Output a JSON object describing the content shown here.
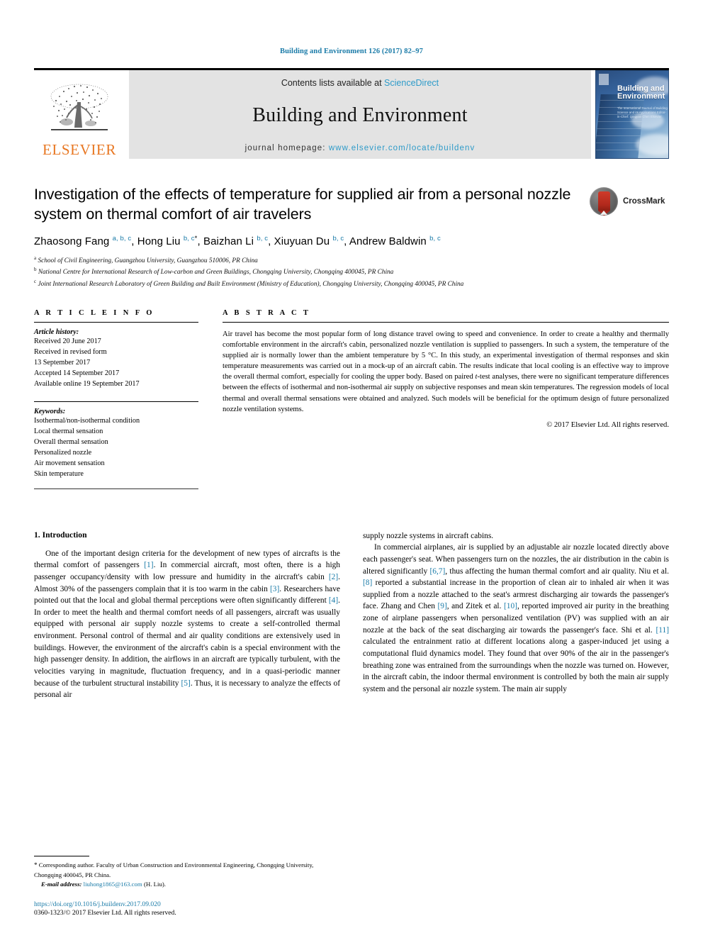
{
  "running_head": "Building and Environment 126 (2017) 82–97",
  "masthead": {
    "publisher_logo_label": "ELSEVIER",
    "contents_prefix": "Contents lists available at ",
    "contents_link": "ScienceDirect",
    "journal_title": "Building and Environment",
    "homepage_prefix": "journal homepage: ",
    "homepage_url": "www.elsevier.com/locate/buildenv",
    "cover_title_line1": "Building and",
    "cover_title_line2": "Environment",
    "cover_subtitle": "The International Journal of Building Science and its Applications Editor-in-Chief: Qingyan Chen  Elsevier"
  },
  "article": {
    "title": "Investigation of the effects of temperature for supplied air from a personal nozzle system on thermal comfort of air travelers",
    "authors": [
      {
        "name": "Zhaosong Fang",
        "marks": "a, b, c",
        "star": ""
      },
      {
        "name": "Hong Liu",
        "marks": "b, c",
        "star": "*"
      },
      {
        "name": "Baizhan Li",
        "marks": "b, c",
        "star": ""
      },
      {
        "name": "Xiuyuan Du",
        "marks": "b, c",
        "star": ""
      },
      {
        "name": "Andrew Baldwin",
        "marks": "b, c",
        "star": ""
      }
    ],
    "affiliations": [
      {
        "mark": "a",
        "text": "School of Civil Engineering, Guangzhou University, Guangzhou 510006, PR China"
      },
      {
        "mark": "b",
        "text": "National Centre for International Research of Low-carbon and Green Buildings, Chongqing University, Chongqing 400045, PR China"
      },
      {
        "mark": "c",
        "text": "Joint International Research Laboratory of Green Building and Built Environment (Ministry of Education), Chongqing University, Chongqing 400045, PR China"
      }
    ],
    "crossmark_label": "CrossMark"
  },
  "article_info": {
    "heading": "A R T I C L E  I N F O",
    "history_label": "Article history:",
    "history_lines": [
      "Received 20 June 2017",
      "Received in revised form",
      "13 September 2017",
      "Accepted 14 September 2017",
      "Available online 19 September 2017"
    ],
    "keywords_label": "Keywords:",
    "keywords": [
      "Isothermal/non-isothermal condition",
      "Local thermal sensation",
      "Overall thermal sensation",
      "Personalized nozzle",
      "Air movement sensation",
      "Skin temperature"
    ]
  },
  "abstract": {
    "heading": "A B S T R A C T",
    "text_part1": "Air travel has become the most popular form of long distance travel owing to speed and convenience. In order to create a healthy and thermally comfortable environment in the aircraft's cabin, personalized nozzle ventilation is supplied to passengers. In such a system, the temperature of the supplied air is normally lower than the ambient temperature by 5 °C. In this study, an experimental investigation of thermal responses and skin temperature measurements was carried out in a mock-up of an aircraft cabin. The results indicate that local cooling is an effective way to improve the overall thermal comfort, especially for cooling the upper body. Based on paired ",
    "text_italic": "t",
    "text_part2": "-test analyses, there were no significant temperature differences between the effects of isothermal and non-isothermal air supply on subjective responses and mean skin temperatures. The regression models of local thermal and overall thermal sensations were obtained and analyzed. Such models will be beneficial for the optimum design of future personalized nozzle ventilation systems.",
    "copyright": "© 2017 Elsevier Ltd. All rights reserved."
  },
  "body": {
    "section_heading": "1. Introduction",
    "left_para1_a": "One of the important design criteria for the development of new types of aircrafts is the thermal comfort of passengers ",
    "left_para1_r1": "[1]",
    "left_para1_b": ". In commercial aircraft, most often, there is a high passenger occupancy/density with low pressure and humidity in the aircraft's cabin ",
    "left_para1_r2": "[2]",
    "left_para1_c": ". Almost 30% of the passengers complain that it is too warm in the cabin ",
    "left_para1_r3": "[3]",
    "left_para1_d": ". Researchers have pointed out that the local and global thermal perceptions were often significantly different ",
    "left_para1_r4": "[4]",
    "left_para1_e": ". In order to meet the health and thermal comfort needs of all passengers, aircraft was usually equipped with personal air supply nozzle systems to create a self-controlled thermal environment. Personal control of thermal and air quality conditions are extensively used in buildings. However, the environment of the aircraft's cabin is a special environment with the high passenger density. In addition, the airflows in an aircraft are typically turbulent, with the velocities varying in magnitude, fluctuation frequency, and in a quasi-periodic manner because of the turbulent structural instability ",
    "left_para1_r5": "[5]",
    "left_para1_f": ". Thus, it is necessary to analyze the effects of personal air",
    "right_para0": "supply nozzle systems in aircraft cabins.",
    "right_para1_a": "In commercial airplanes, air is supplied by an adjustable air nozzle located directly above each passenger's seat. When passengers turn on the nozzles, the air distribution in the cabin is altered significantly ",
    "right_para1_r1": "[6,7]",
    "right_para1_b": ", thus affecting the human thermal comfort and air quality. Niu et al. ",
    "right_para1_r2": "[8]",
    "right_para1_c": " reported a substantial increase in the proportion of clean air to inhaled air when it was supplied from a nozzle attached to the seat's armrest discharging air towards the passenger's face. Zhang and Chen ",
    "right_para1_r3": "[9]",
    "right_para1_d": ", and Zitek et al. ",
    "right_para1_r4": "[10]",
    "right_para1_e": ", reported improved air purity in the breathing zone of airplane passengers when personalized ventilation (PV) was supplied with an air nozzle at the back of the seat discharging air towards the passenger's face. Shi et al. ",
    "right_para1_r5": "[11]",
    "right_para1_f": " calculated the entrainment ratio at different locations along a gasper-induced jet using a computational fluid dynamics model. They found that over 90% of the air in the passenger's breathing zone was entrained from the surroundings when the nozzle was turned on. However, in the aircraft cabin, the indoor thermal environment is controlled by both the main air supply system and the personal air nozzle system. The main air supply"
  },
  "footnote": {
    "star": "*",
    "corresponding": " Corresponding author. Faculty of Urban Construction and Environmental Engineering, Chongqing University, Chongqing 400045, PR China.",
    "email_label": "E-mail address:",
    "email": "liuhong1865@163.com",
    "email_suffix": " (H. Liu).",
    "doi": "https://doi.org/10.1016/j.buildenv.2017.09.020",
    "issn": "0360-1323/© 2017 Elsevier Ltd. All rights reserved."
  },
  "colors": {
    "link": "#1a7ba8",
    "sciencedirect": "#2e9bc9",
    "elsevier_orange": "#E87722",
    "band_gray": "#e3e3e3"
  }
}
